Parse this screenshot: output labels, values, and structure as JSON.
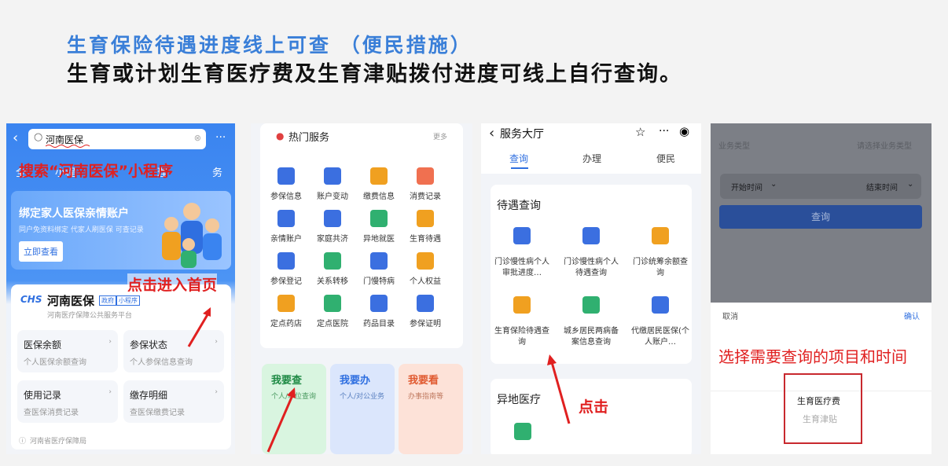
{
  "slide": {
    "title": "生育保险待遇进度线上可查 （便民措施）",
    "subtitle": "生育或计划生育医疗费及生育津贴拨付进度可线上自行查询。"
  },
  "panel1": {
    "search_value": "河南医保",
    "tabs": [
      "全",
      "小程",
      "理",
      "务"
    ],
    "annotation_search": "搜索“河南医保”小程序",
    "banner_title": "绑定家人医保亲情账户",
    "banner_desc": "同户免资料绑定 代家人刷医保 可查记录",
    "banner_button": "立即查看",
    "app_name": "河南医保",
    "app_tag_gov": "政府",
    "app_tag_mini": "小程序",
    "app_desc": "河南医疗保障公共服务平台",
    "annotation_home": "点击进入首页",
    "cells": [
      {
        "title": "医保余额",
        "desc": "个人医保余额查询"
      },
      {
        "title": "参保状态",
        "desc": "个人参保信息查询"
      },
      {
        "title": "使用记录",
        "desc": "查医保消费记录"
      },
      {
        "title": "缴存明细",
        "desc": "查医保缴费记录"
      }
    ],
    "footer": "河南省医疗保障局"
  },
  "panel2": {
    "section_title": "热门服务",
    "more": "更多",
    "services": [
      {
        "label": "参保信息",
        "color": "#3b6fe0"
      },
      {
        "label": "账户变动",
        "color": "#3b6fe0"
      },
      {
        "label": "缴费信息",
        "color": "#f0a020"
      },
      {
        "label": "消费记录",
        "color": "#f07050"
      },
      {
        "label": "亲情账户",
        "color": "#3b6fe0"
      },
      {
        "label": "家庭共济",
        "color": "#3b6fe0"
      },
      {
        "label": "异地就医",
        "color": "#30b070"
      },
      {
        "label": "生育待遇",
        "color": "#f0a020"
      },
      {
        "label": "参保登记",
        "color": "#3b6fe0"
      },
      {
        "label": "关系转移",
        "color": "#30b070"
      },
      {
        "label": "门慢特病",
        "color": "#3b6fe0"
      },
      {
        "label": "个人权益",
        "color": "#f0a020"
      },
      {
        "label": "定点药店",
        "color": "#f0a020"
      },
      {
        "label": "定点医院",
        "color": "#30b070"
      },
      {
        "label": "药品目录",
        "color": "#3b6fe0"
      },
      {
        "label": "参保证明",
        "color": "#3b6fe0"
      }
    ],
    "tiles": [
      {
        "title": "我要查",
        "desc": "个人/单位查询"
      },
      {
        "title": "我要办",
        "desc": "个人/对公业务"
      },
      {
        "title": "我要看",
        "desc": "办事指南等"
      }
    ]
  },
  "panel3": {
    "nav_title": "服务大厅",
    "tabs": [
      "查询",
      "办理",
      "便民"
    ],
    "section1": "待遇查询",
    "items": [
      {
        "label": "门诊慢性病个人审批进度…",
        "color": "#3b6fe0"
      },
      {
        "label": "门诊慢性病个人待遇查询",
        "color": "#3b6fe0"
      },
      {
        "label": "门诊统筹余额查询",
        "color": "#f0a020"
      },
      {
        "label": "生育保险待遇查询",
        "color": "#f0a020"
      },
      {
        "label": "城乡居民两病备案信息查询",
        "color": "#30b070"
      },
      {
        "label": "代缴居民医保(个人账户…",
        "color": "#3b6fe0"
      }
    ],
    "section2": "异地医疗",
    "annotation_click": "点击"
  },
  "panel4": {
    "field_label": "业务类型",
    "field_placeholder": "请选择业务类型",
    "start_time": "开始时间",
    "end_time": "结束时间",
    "query_button": "查询",
    "cancel": "取消",
    "confirm": "确认",
    "annotation": "选择需要查询的项目和时间",
    "options": [
      "生育医疗费",
      "生育津贴"
    ]
  }
}
